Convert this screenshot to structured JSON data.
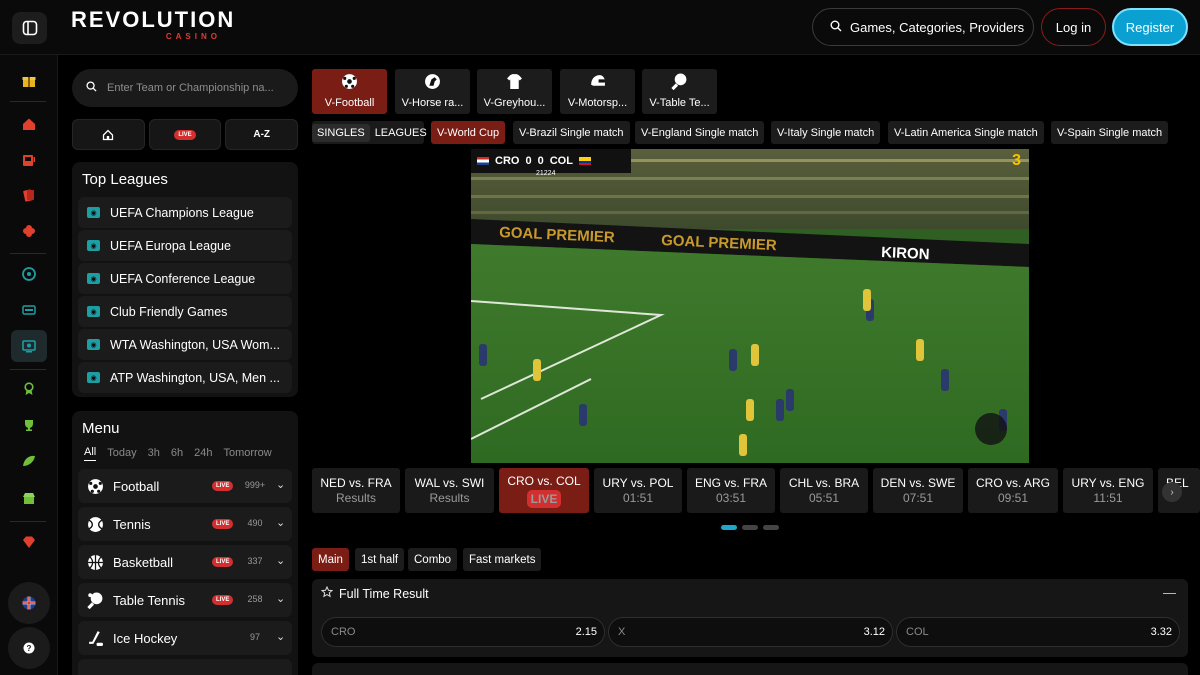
{
  "header": {
    "logo_main": "REVOLUTION",
    "logo_sub": "CASINO",
    "search_label": "Games, Categories, Providers",
    "login_label": "Log in",
    "register_label": "Register"
  },
  "sidebar": {
    "team_search_placeholder": "Enter Team or Championship na...",
    "quick_live": "LIVE",
    "quick_az": "A-Z",
    "top_leagues_title": "Top Leagues",
    "leagues": [
      "UEFA Champions League",
      "UEFA Europa League",
      "UEFA Conference League",
      "Club Friendly Games",
      "WTA Washington, USA Wom...",
      "ATP Washington, USA, Men ..."
    ],
    "menu_title": "Menu",
    "menu_filters": [
      "All",
      "Today",
      "3h",
      "6h",
      "24h",
      "Tomorrow"
    ],
    "sports": [
      {
        "name": "Football",
        "live": "LIVE",
        "count": "999+"
      },
      {
        "name": "Tennis",
        "live": "LIVE",
        "count": "490"
      },
      {
        "name": "Basketball",
        "live": "LIVE",
        "count": "337"
      },
      {
        "name": "Table Tennis",
        "live": "LIVE",
        "count": "258"
      },
      {
        "name": "Ice Hockey",
        "live": "",
        "count": "97"
      }
    ]
  },
  "categories": [
    "V-Football",
    "V-Horse ra...",
    "V-Greyhou...",
    "V-Motorsp...",
    "V-Table Te..."
  ],
  "chips": {
    "group": [
      "SINGLES",
      "LEAGUES"
    ],
    "items": [
      "V-World Cup",
      "V-Brazil Single match",
      "V-England Single match",
      "V-Italy Single match",
      "V-Latin America Single match",
      "V-Spain Single match"
    ]
  },
  "video": {
    "home": "CRO",
    "away": "COL",
    "home_score": "0",
    "away_score": "0",
    "match_id": "21224",
    "period": "3",
    "board_text_1": "GOAL PREMIER",
    "board_text_2": "GOAL PREMIER",
    "board_brand": "KIRON"
  },
  "matches": [
    {
      "title": "NED vs. FRA",
      "sub": "Results"
    },
    {
      "title": "WAL vs. SWI",
      "sub": "Results"
    },
    {
      "title": "CRO vs. COL",
      "sub": "LIVE"
    },
    {
      "title": "URY vs. POL",
      "sub": "01:51"
    },
    {
      "title": "ENG vs. FRA",
      "sub": "03:51"
    },
    {
      "title": "CHL vs. BRA",
      "sub": "05:51"
    },
    {
      "title": "DEN vs. SWE",
      "sub": "07:51"
    },
    {
      "title": "CRO vs. ARG",
      "sub": "09:51"
    },
    {
      "title": "URY vs. ENG",
      "sub": "11:51"
    },
    {
      "title": "BEL",
      "sub": ""
    }
  ],
  "market_tabs": [
    "Main",
    "1st half",
    "Combo",
    "Fast markets"
  ],
  "market": {
    "title": "Full Time Result",
    "odds": [
      {
        "label": "CRO",
        "value": "2.15"
      },
      {
        "label": "X",
        "value": "3.12"
      },
      {
        "label": "COL",
        "value": "3.32"
      }
    ]
  },
  "colors": {
    "accent_red": "#7a1d14",
    "register_blue": "#0aa1d2",
    "live_red": "#d32f2f",
    "league_icon": "#1e9ea3"
  }
}
